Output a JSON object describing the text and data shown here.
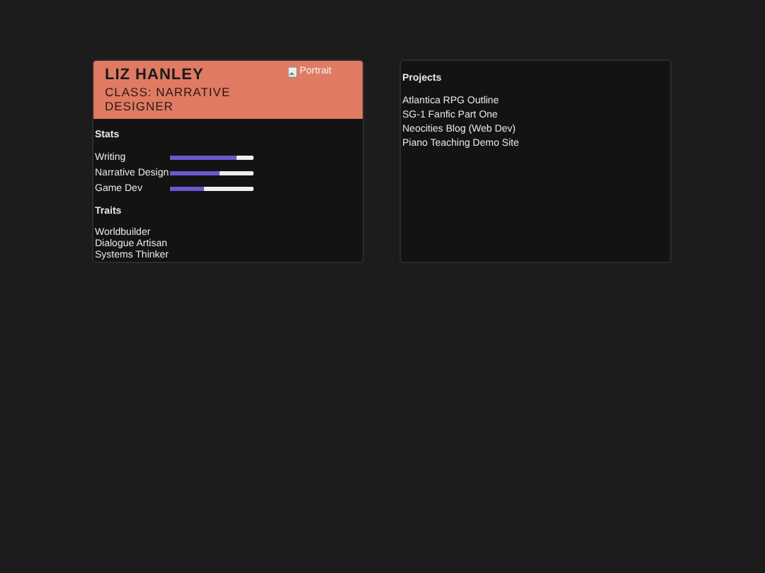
{
  "profile": {
    "name": "LIZ HANLEY",
    "class": "CLASS: NARRATIVE DESIGNER",
    "portrait_alt": "Portrait"
  },
  "stats": {
    "title": "Stats",
    "items": [
      {
        "label": "Writing",
        "level": 0.8
      },
      {
        "label": "Narrative Design",
        "level": 0.6
      },
      {
        "label": "Game Dev",
        "level": 0.4
      }
    ]
  },
  "traits": {
    "title": "Traits",
    "items": [
      "Worldbuilder",
      "Dialogue Artisan",
      "Systems Thinker"
    ]
  },
  "projects": {
    "title": "Projects",
    "items": [
      "Atlantica RPG Outline",
      "SG-1 Fanfic Part One",
      "Neocities Blog (Web Dev)",
      "Piano Teaching Demo Site"
    ]
  }
}
